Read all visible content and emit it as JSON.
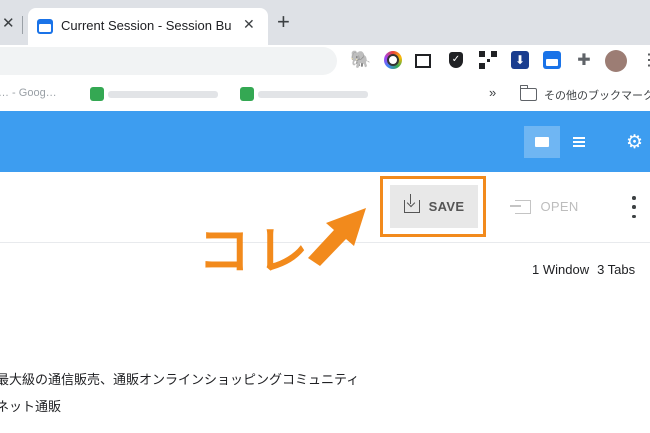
{
  "browser": {
    "active_tab_title": "Current Session - Session Buddy",
    "new_tab_symbol": "+",
    "close_symbol": "✕"
  },
  "toolbar": {
    "extensions": [
      "evernote-icon",
      "color-picker-icon",
      "screen-capture-icon",
      "shield-icon",
      "qr-code-icon",
      "download-icon",
      "session-buddy-icon",
      "puzzle-icon"
    ],
    "menu_symbol": "⋮"
  },
  "bookmarks": {
    "item1_label": "… - Goog…",
    "more_symbol": "»",
    "other_folder_label": "その他のブックマーク"
  },
  "app": {
    "header_color": "#3d9df0",
    "gear_symbol": "⚙",
    "save_label": "SAVE",
    "open_label": "OPEN",
    "window_count": "1 Window",
    "tab_count": "3 Tabs",
    "content_line1": "最大級の通信販売、通販オンラインショッピングコミュニティ",
    "content_line2": "ネット通販"
  },
  "annotation": {
    "text": "コレ",
    "color": "#f28a1c"
  }
}
